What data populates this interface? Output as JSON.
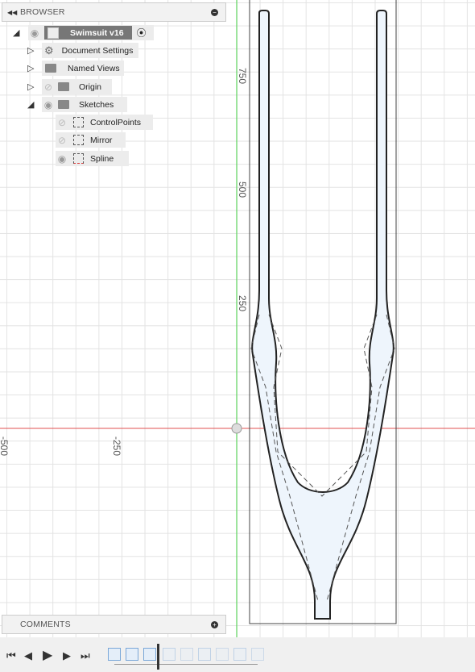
{
  "browser": {
    "title": "BROWSER",
    "root": "Swimsuit v16",
    "items": [
      {
        "label": "Document Settings",
        "icon": "gear-icon"
      },
      {
        "label": "Named Views",
        "icon": "folder-icon"
      },
      {
        "label": "Origin",
        "icon": "folder-icon",
        "visible": false
      },
      {
        "label": "Sketches",
        "icon": "folder-icon",
        "visible": true
      }
    ],
    "sketches": [
      {
        "label": "ControlPoints",
        "visible": false
      },
      {
        "label": "Mirror",
        "visible": false
      },
      {
        "label": "Spline",
        "visible": true
      }
    ]
  },
  "comments": {
    "title": "COMMENTS"
  },
  "axis": {
    "y": [
      "750",
      "500",
      "250"
    ],
    "x": [
      "-500",
      "-250"
    ]
  },
  "colors": {
    "x_axis": "#e05050",
    "y_axis": "#40d040",
    "fill": "#eaf3fc"
  }
}
